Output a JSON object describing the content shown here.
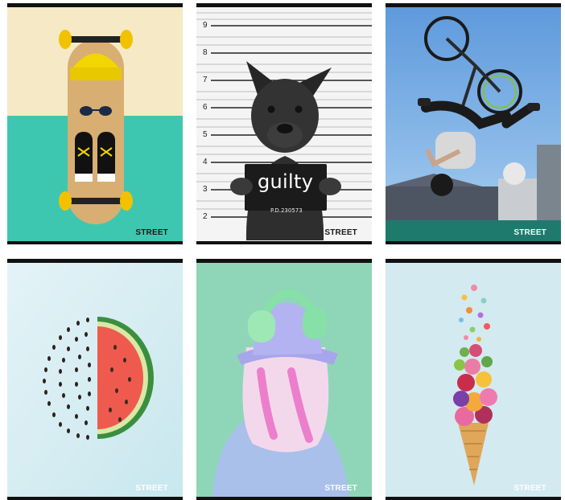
{
  "brand": "STREET",
  "cards": [
    {
      "subject": "skateboard",
      "brand": "STREET",
      "brand_color": "dark"
    },
    {
      "subject": "dog-mugshot",
      "brand": "STREET",
      "brand_color": "dark",
      "sign_text": "guilty",
      "sign_code": "P.D.230573",
      "height_marks": [
        "9",
        "8",
        "7",
        "6",
        "5",
        "4",
        "3",
        "2"
      ]
    },
    {
      "subject": "bmx",
      "brand": "STREET",
      "brand_color": "light"
    },
    {
      "subject": "watermelon",
      "brand": "STREET",
      "brand_color": "light"
    },
    {
      "subject": "headphones",
      "brand": "STREET",
      "brand_color": "light"
    },
    {
      "subject": "flower-cone",
      "brand": "STREET",
      "brand_color": "light"
    }
  ],
  "colors": {
    "teal": "#3ec7b0",
    "cream": "#f6e9c6",
    "sky": "#6da8e3",
    "mint": "#8fd6b8",
    "pale_blue": "#d3eaf1"
  }
}
